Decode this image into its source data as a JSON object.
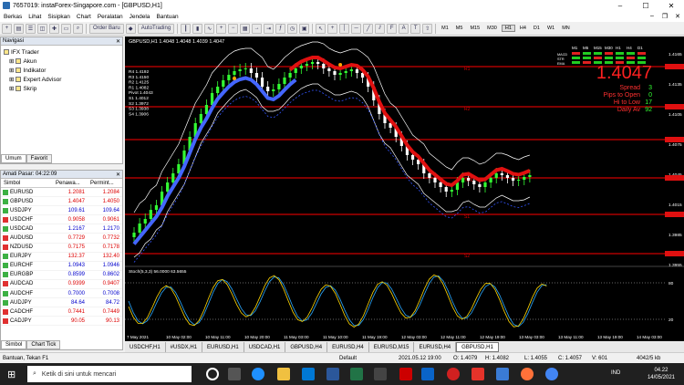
{
  "window": {
    "title": "7657019: instaForex-Singapore.com - [GBPUSD,H1]",
    "min": "–",
    "max": "☐",
    "close": "✕"
  },
  "menu": {
    "items": [
      "Berkas",
      "Lihat",
      "Sisipkan",
      "Chart",
      "Peralatan",
      "Jendela",
      "Bantuan"
    ],
    "right": [
      "–",
      "❐",
      "✕"
    ]
  },
  "toolbar": {
    "order_label": "Order Baru",
    "autotrade_label": "AutoTrading",
    "timeframes": [
      "M1",
      "M5",
      "M15",
      "M30",
      "H1",
      "H4",
      "D1",
      "W1",
      "MN"
    ],
    "selected_tf": "H1"
  },
  "navigator": {
    "title": "Navigasi",
    "items": [
      "IFX Trader",
      "Akun",
      "Indikator",
      "Expert Advisor",
      "Skrip"
    ],
    "tabs": [
      "Umum",
      "Favorit"
    ]
  },
  "market_watch": {
    "title": "Amati Pasar: 04:22:09",
    "headers": [
      "Simbol",
      "Penawa...",
      "Permint..."
    ],
    "rows": [
      {
        "symbol": "EURUSD",
        "bid": "1.2081",
        "ask": "1.2084",
        "dir": "up",
        "color": "red"
      },
      {
        "symbol": "GBPUSD",
        "bid": "1.4047",
        "ask": "1.4050",
        "dir": "up",
        "color": "red"
      },
      {
        "symbol": "USDJPY",
        "bid": "109.61",
        "ask": "109.64",
        "dir": "up",
        "color": "blue"
      },
      {
        "symbol": "USDCHF",
        "bid": "0.9058",
        "ask": "0.9061",
        "dir": "dn",
        "color": "red"
      },
      {
        "symbol": "USDCAD",
        "bid": "1.2167",
        "ask": "1.2170",
        "dir": "up",
        "color": "blue"
      },
      {
        "symbol": "AUDUSD",
        "bid": "0.7729",
        "ask": "0.7732",
        "dir": "dn",
        "color": "red"
      },
      {
        "symbol": "NZDUSD",
        "bid": "0.7175",
        "ask": "0.7178",
        "dir": "dn",
        "color": "red"
      },
      {
        "symbol": "EURJPY",
        "bid": "132.37",
        "ask": "132.40",
        "dir": "up",
        "color": "red"
      },
      {
        "symbol": "EURCHF",
        "bid": "1.0943",
        "ask": "1.0946",
        "dir": "up",
        "color": "blue"
      },
      {
        "symbol": "EURGBP",
        "bid": "0.8599",
        "ask": "0.8602",
        "dir": "up",
        "color": "blue"
      },
      {
        "symbol": "AUDCAD",
        "bid": "0.9399",
        "ask": "0.9407",
        "dir": "dn",
        "color": "red"
      },
      {
        "symbol": "AUDCHF",
        "bid": "0.7000",
        "ask": "0.7008",
        "dir": "up",
        "color": "blue"
      },
      {
        "symbol": "AUDJPY",
        "bid": "84.64",
        "ask": "84.72",
        "dir": "up",
        "color": "blue"
      },
      {
        "symbol": "CADCHF",
        "bid": "0.7441",
        "ask": "0.7449",
        "dir": "dn",
        "color": "red"
      },
      {
        "symbol": "CADJPY",
        "bid": "90.05",
        "ask": "90.13",
        "dir": "dn",
        "color": "red"
      }
    ],
    "tabs": [
      "Simbol",
      "Chart Tick"
    ]
  },
  "chart": {
    "header": "GBPUSD,H1  1.4048 1.4048 1.4039 1.4047",
    "pivot_labels": [
      "R4 1.4192",
      "R3 1.4150",
      "R2 1.4125",
      "R1 1.4082",
      "Pivot 1.4043",
      "S1 1.4012",
      "S2 1.3972",
      "S3 1.3938",
      "S4 1.3906"
    ],
    "price_big": "1.4047",
    "stats": [
      {
        "label": "Spread",
        "value": "3"
      },
      {
        "label": "Pips to Open",
        "value": "0"
      },
      {
        "label": "Hi to Low",
        "value": "17"
      },
      {
        "label": "Daily Av",
        "value": "92"
      }
    ],
    "mtf_headers": [
      "M1",
      "M5",
      "M15",
      "M30",
      "H1",
      "H4",
      "D1"
    ],
    "mtf_rows": [
      "MACD",
      "STR",
      "EMA"
    ],
    "line_labels": [
      "R1",
      "R2",
      "S1",
      "S2",
      "Pivot"
    ],
    "yticks": [
      "1.4165",
      "1.4135",
      "1.4105",
      "1.4075",
      "1.4045",
      "1.4015",
      "1.3985",
      "1.3955"
    ],
    "osc_label": "Stoch(5,3,3) 56.0000 63.5655",
    "osc_ticks": [
      "80",
      "20"
    ],
    "xticks": [
      "7 May 2021",
      "10 May 02:00",
      "10 May 11:00",
      "10 May 20:00",
      "11 May 03:00",
      "11 May 10:00",
      "11 May 19:00",
      "12 May 03:00",
      "12 May 11:00",
      "12 May 19:00",
      "13 May 03:00",
      "13 May 11:00",
      "13 May 19:00",
      "14 May 03:00"
    ]
  },
  "chart_tabs": [
    "USDCHF,H1",
    "#USDX,H1",
    "EURUSD,H1",
    "USDCAD,H1",
    "GBPUSD,H4",
    "EURUSD,H4",
    "EURUSD,M15",
    "EURUSD,H4",
    "GBPUSD,H1"
  ],
  "statusbar": {
    "help": "Bantuan, Tekan F1",
    "profile": "Default",
    "time": "2021.05.12 19:00",
    "o": "O: 1.4079",
    "h": "H: 1.4082",
    "l": "L: 1.4055",
    "c": "C: 1.4057",
    "v": "V: 601",
    "traffic": "4042/5 kb"
  },
  "taskbar": {
    "search": "Ketik di sini untuk mencari",
    "time": "04.22",
    "date": "14/05/2021",
    "lang": "IND"
  },
  "colors": {
    "chart_bg": "#000000",
    "bull": "#33ff33",
    "bear": "#ffffff",
    "resist": "#ff0000",
    "band": "#ffffff",
    "ma_blue": "#4466ff"
  }
}
